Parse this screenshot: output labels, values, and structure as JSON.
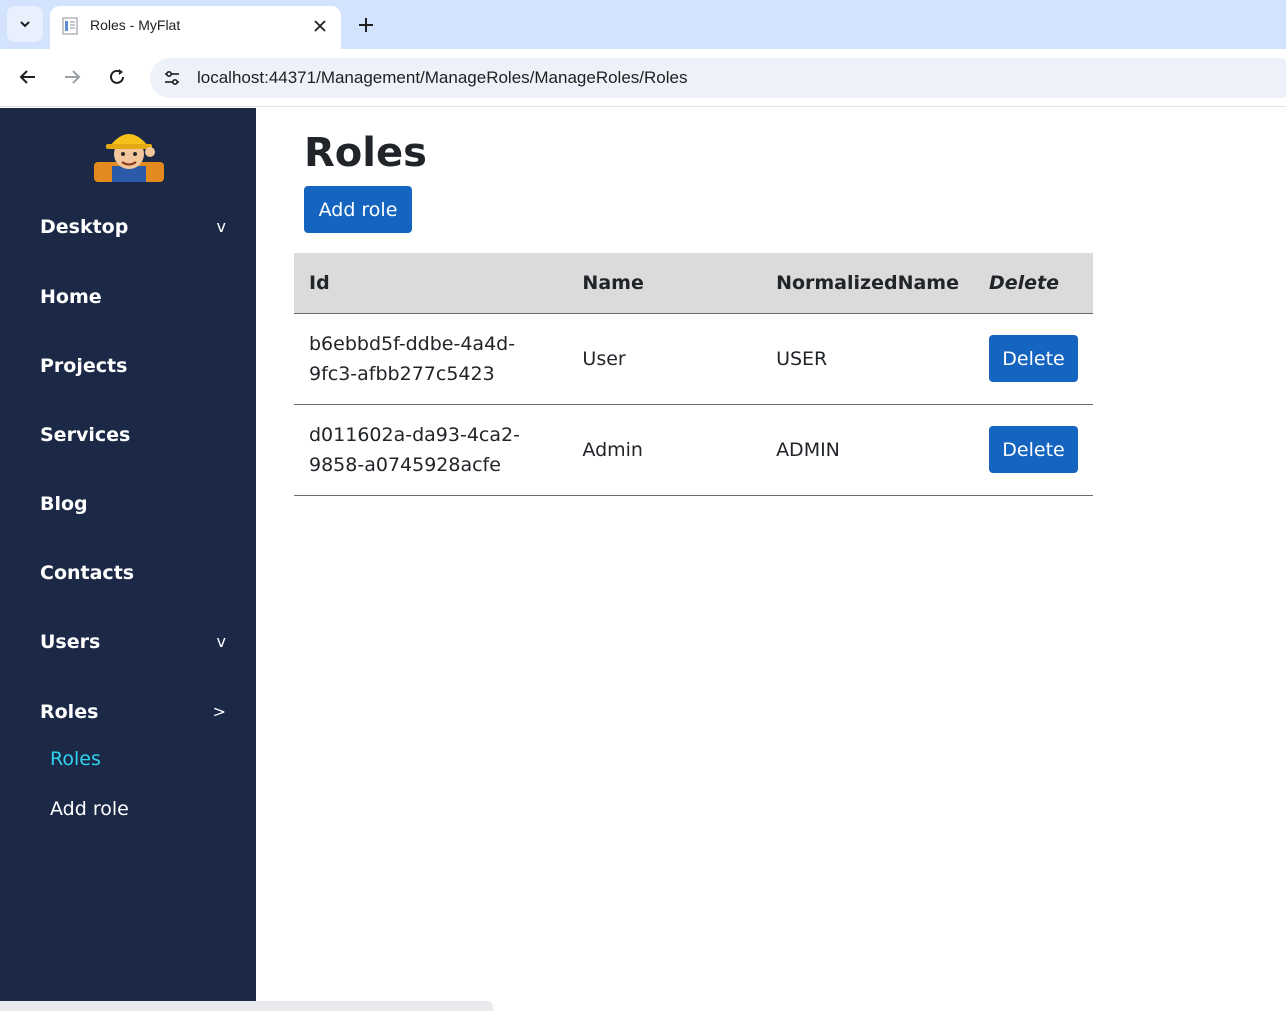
{
  "browser": {
    "tab_title": "Roles - MyFlat",
    "url": "localhost:44371/Management/ManageRoles/ManageRoles/Roles"
  },
  "sidebar": {
    "items": [
      {
        "label": "Desktop",
        "chevron": "v"
      },
      {
        "label": "Home",
        "chevron": ""
      },
      {
        "label": "Projects",
        "chevron": ""
      },
      {
        "label": "Services",
        "chevron": ""
      },
      {
        "label": "Blog",
        "chevron": ""
      },
      {
        "label": "Contacts",
        "chevron": ""
      },
      {
        "label": "Users",
        "chevron": "v"
      },
      {
        "label": "Roles",
        "chevron": ">"
      }
    ],
    "subitems": [
      {
        "label": "Roles",
        "active": true
      },
      {
        "label": "Add role",
        "active": false
      }
    ]
  },
  "main": {
    "title": "Roles",
    "add_button": "Add role",
    "table": {
      "headers": [
        "Id",
        "Name",
        "NormalizedName",
        "Delete"
      ],
      "rows": [
        {
          "id": "b6ebbd5f-ddbe-4a4d-9fc3-afbb277c5423",
          "name": "User",
          "normalized": "USER",
          "delete": "Delete"
        },
        {
          "id": "d011602a-da93-4ca2-9858-a0745928acfe",
          "name": "Admin",
          "normalized": "ADMIN",
          "delete": "Delete"
        }
      ]
    }
  },
  "colors": {
    "sidebar_bg": "#1b2947",
    "accent": "#1565c0",
    "active_link": "#2fd3f0",
    "tab_strip": "#d3e3fd"
  }
}
